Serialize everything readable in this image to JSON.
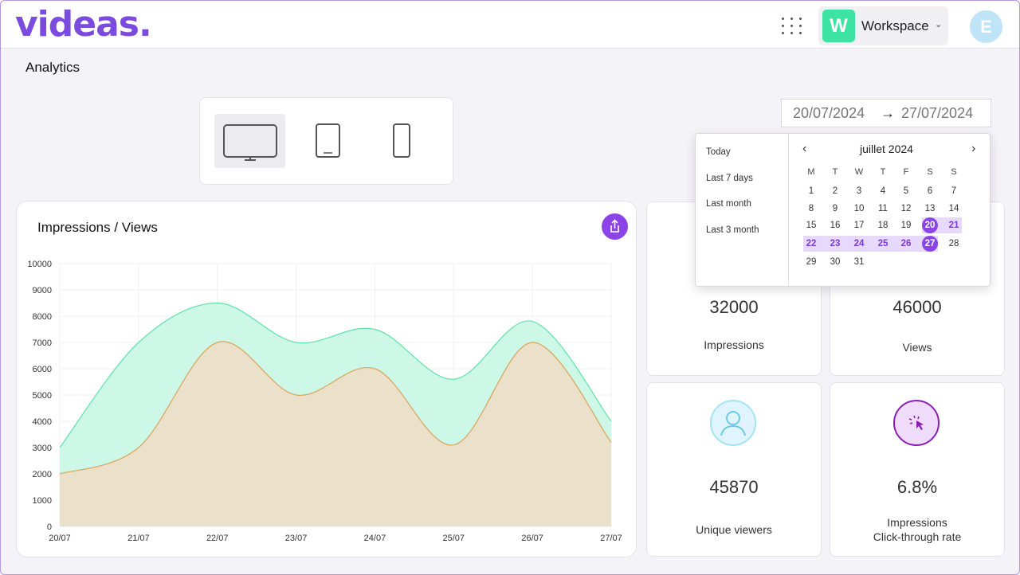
{
  "app": {
    "logo": "videas."
  },
  "header": {
    "workspace_badge": "W",
    "workspace_label": "Workspace",
    "avatar_initial": "E",
    "apps_icon": "grid-dots-icon",
    "colors": {
      "brand": "#7b4be0",
      "workspace_badge": "#3de3a2",
      "avatar": "#bfe3f7"
    }
  },
  "page": {
    "title": "Analytics"
  },
  "devices": {
    "options": [
      "desktop",
      "tablet",
      "mobile"
    ],
    "selected": "desktop"
  },
  "date_range": {
    "start": "20/07/2024",
    "arrow": "→",
    "end": "27/07/2024"
  },
  "picker": {
    "presets": [
      "Today",
      "Last 7 days",
      "Last month",
      "Last 3 month"
    ],
    "month_label": "juillet 2024",
    "weekdays": [
      "M",
      "T",
      "W",
      "T",
      "F",
      "S",
      "S"
    ],
    "first_weekday_index": 0,
    "days_in_month": 31,
    "range_start": 20,
    "range_end": 27,
    "accent": "#8b45e6",
    "range_fill": "#e7d9fb"
  },
  "chart": {
    "title": "Impressions / Views",
    "export_icon": "share-export-icon"
  },
  "chart_data": {
    "type": "area",
    "x": [
      "20/07",
      "21/07",
      "22/07",
      "23/07",
      "24/07",
      "25/07",
      "26/07",
      "27/07"
    ],
    "ylim": [
      0,
      10000
    ],
    "yticks": [
      0,
      1000,
      2000,
      3000,
      4000,
      5000,
      6000,
      7000,
      8000,
      9000,
      10000
    ],
    "grid": true,
    "series": [
      {
        "values": [
          3000,
          7000,
          8500,
          7000,
          7500,
          5600,
          7800,
          4000
        ],
        "color": "#cdf7e6",
        "stroke": "#5fe3a9"
      },
      {
        "values": [
          2000,
          3000,
          7000,
          5000,
          6000,
          3100,
          7000,
          3200
        ],
        "color": "#ebe0c9",
        "stroke": "#d9a45a"
      }
    ]
  },
  "stats": [
    {
      "value": "32000",
      "label": "Impressions"
    },
    {
      "value": "46000",
      "label": "Views"
    },
    {
      "value": "45870",
      "label": "Unique viewers",
      "icon": "user-icon"
    },
    {
      "value": "6.8%",
      "label_line1": "Impressions",
      "label_line2": "Click-through rate",
      "icon": "cursor-click-icon"
    }
  ]
}
